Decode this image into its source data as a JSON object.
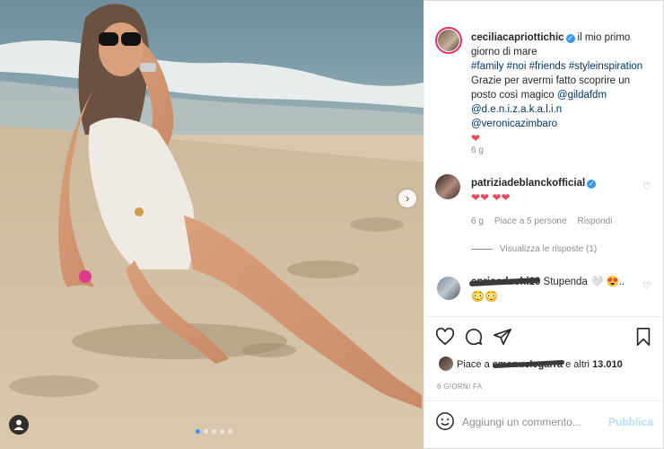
{
  "post": {
    "author": "ceciliacapriottichic",
    "caption_text": "il mio primo giorno di mare",
    "hashtags": [
      "#family",
      "#noi",
      "#friends",
      "#styleinspiration"
    ],
    "caption_body": "Grazie per avermi fatto scoprire un posto così magico",
    "mentions": [
      "@gildafdm",
      "@d.e.n.i.z.a.k.a.l.i.n",
      "@veronicazimbaro"
    ],
    "caption_emoji": "❤",
    "caption_time": "6 g",
    "carousel_next_label": "›",
    "carousel_total": 5,
    "carousel_active": 1
  },
  "comments": [
    {
      "author": "patriziadeblanckofficial",
      "text": "❤❤ ❤❤",
      "time": "6 g",
      "likes": "Piace a 5 persone",
      "reply": "Rispondi",
      "view_replies": "Visualizza le risposte (1)"
    },
    {
      "author": "enricodechi10",
      "text": "Stupenda 🤍 😍..",
      "emoji_line": "😳😳"
    }
  ],
  "actions": {
    "like_icon": "heart-outline-icon",
    "comment_icon": "comment-bubble-icon",
    "share_icon": "paper-plane-icon",
    "save_icon": "bookmark-icon"
  },
  "liked_by": {
    "prefix": "Piace a",
    "user": "emanuelegarra",
    "suffix": "e altri",
    "count": "13.010"
  },
  "time_ago": "6 GIORNI FA",
  "comment_box": {
    "placeholder": "Aggiungi un commento...",
    "submit": "Pubblica"
  },
  "colors": {
    "link": "#00376b",
    "accent_blue": "#3897f0",
    "heart_red": "#ed4956",
    "publish_disabled": "#b2dffc",
    "muted": "#8e8e8e"
  }
}
